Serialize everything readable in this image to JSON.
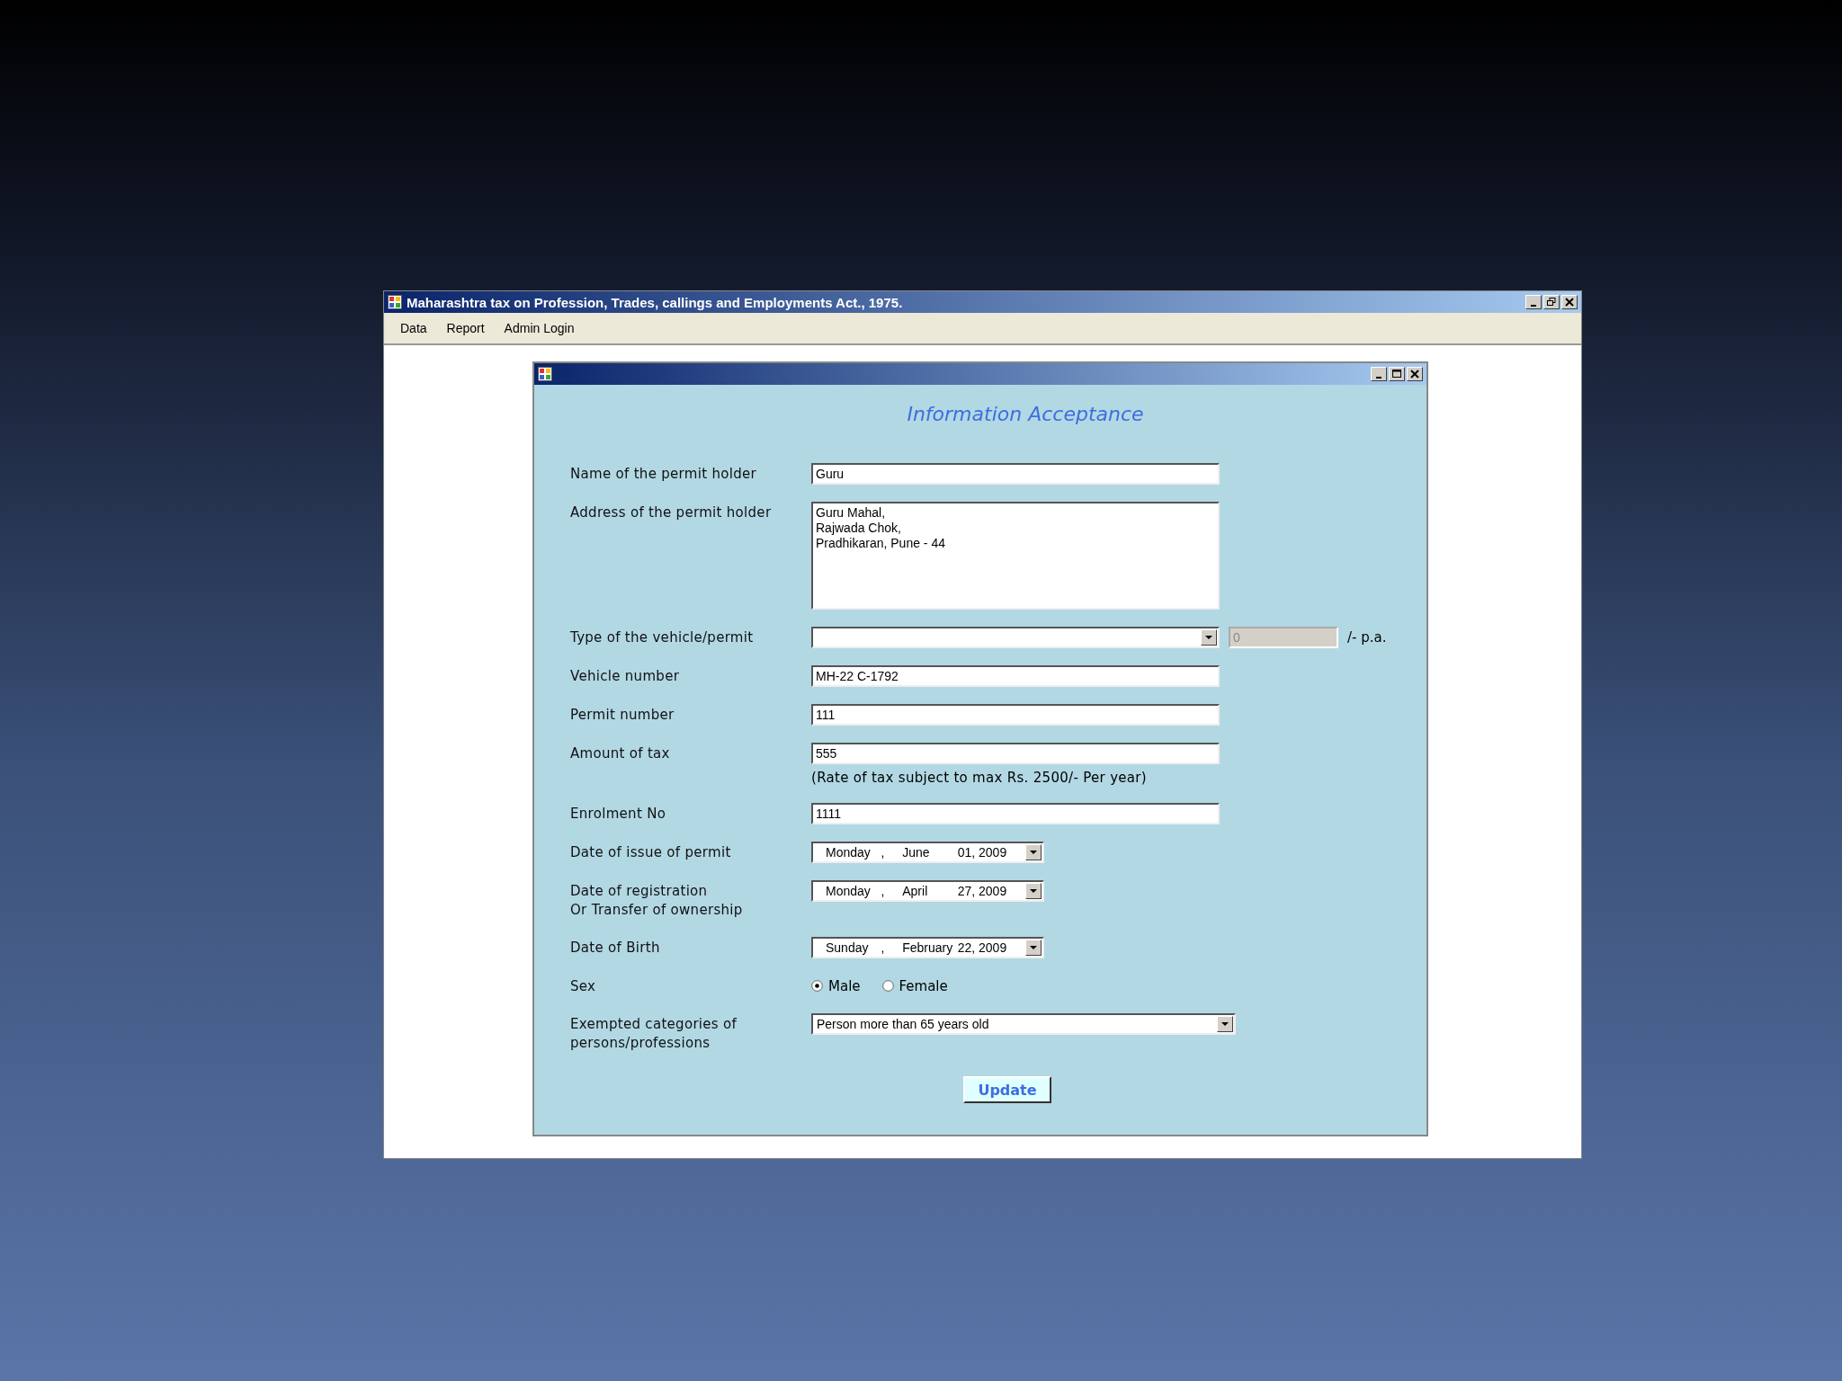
{
  "window": {
    "title": "Maharashtra tax on Profession, Trades, callings and Employments Act., 1975.",
    "menu": [
      {
        "label": "Data"
      },
      {
        "label": "Report"
      },
      {
        "label": "Admin Login"
      }
    ]
  },
  "form_window": {
    "heading": "Information Acceptance",
    "fields": [
      {
        "kind": "text",
        "label": "Name of the permit holder",
        "value": "Guru"
      },
      {
        "kind": "textarea",
        "label": "Address of the permit holder",
        "value": "Guru Mahal,\nRajwada Chok,\nPradhikaran, Pune - 44"
      },
      {
        "kind": "combo_rate",
        "label": "Type of the vehicle/permit",
        "rate": "0",
        "rate_disabled": true,
        "suffix": "/- p.a."
      },
      {
        "kind": "text",
        "label": "Vehicle number",
        "value": "MH-22 C-1792"
      },
      {
        "kind": "text",
        "label": "Permit number",
        "value": "111"
      },
      {
        "kind": "text",
        "label": "Amount of tax",
        "value": "555",
        "note": "(Rate of tax subject to max Rs. 2500/- Per year)"
      },
      {
        "kind": "text",
        "label": "Enrolment No",
        "value": "1111"
      },
      {
        "kind": "date",
        "label": "Date of issue of permit",
        "weekday": "Monday",
        "separator": ",",
        "month": "June",
        "date": "01, 2009"
      },
      {
        "kind": "date",
        "label": "Date of registration\nOr Transfer of ownership",
        "weekday": "Monday",
        "separator": ",",
        "month": "April",
        "date": "27, 2009"
      },
      {
        "kind": "date",
        "label": "Date of Birth",
        "weekday": "Sunday",
        "separator": ",",
        "month": "February",
        "date": "22, 2009"
      },
      {
        "kind": "radio",
        "label": "Sex",
        "options": [
          {
            "label": "Male",
            "selected": true
          },
          {
            "label": "Female",
            "selected": false
          }
        ]
      },
      {
        "kind": "dropdown",
        "label": "Exempted categories of\npersons/professions",
        "value": "Person more than 65 years old"
      }
    ],
    "update_button": "Update"
  }
}
